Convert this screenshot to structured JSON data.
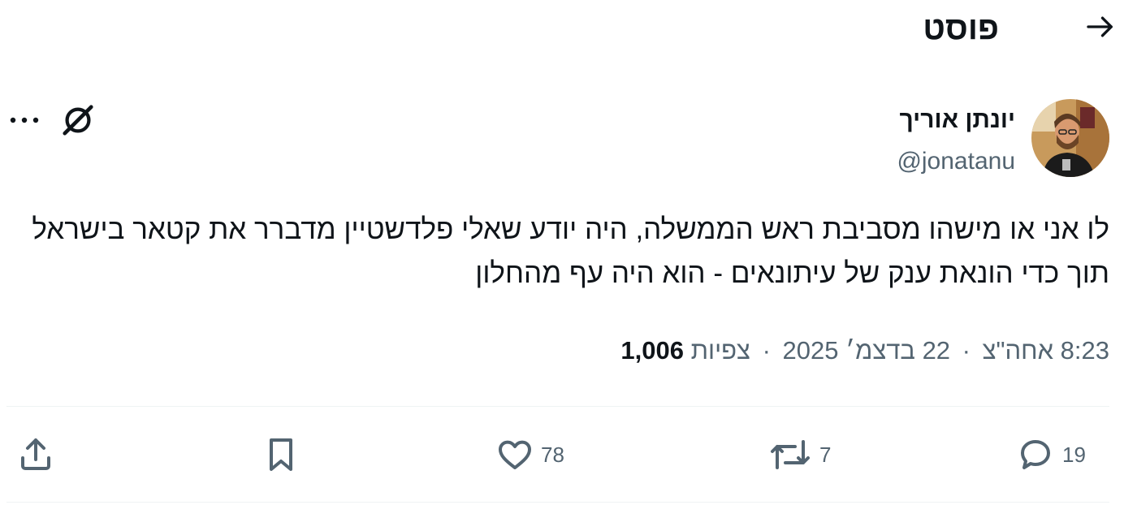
{
  "header": {
    "title": "פוסט",
    "back_icon": "arrow-right-icon"
  },
  "author": {
    "name": "יונתן אוריך",
    "handle": "@jonatanu",
    "avatar_icon": "user-avatar"
  },
  "tweet": {
    "text": "לו אני או מישהו מסביבת ראש הממשלה, היה יודע שאלי פלדשטיין מדברר את קטאר בישראל תוך כדי הונאת ענק של עיתונאים - הוא היה עף מהחלון"
  },
  "meta": {
    "time": "8:23 אחה\"צ",
    "date": "22 בדצמ׳ 2025",
    "views_count": "1,006",
    "views_label": "צפיות",
    "separator": "·"
  },
  "actions": {
    "reply_count": "19",
    "repost_count": "7",
    "like_count": "78"
  },
  "colors": {
    "text": "#0f1419",
    "secondary": "#536471",
    "divider": "#eff3f4"
  }
}
